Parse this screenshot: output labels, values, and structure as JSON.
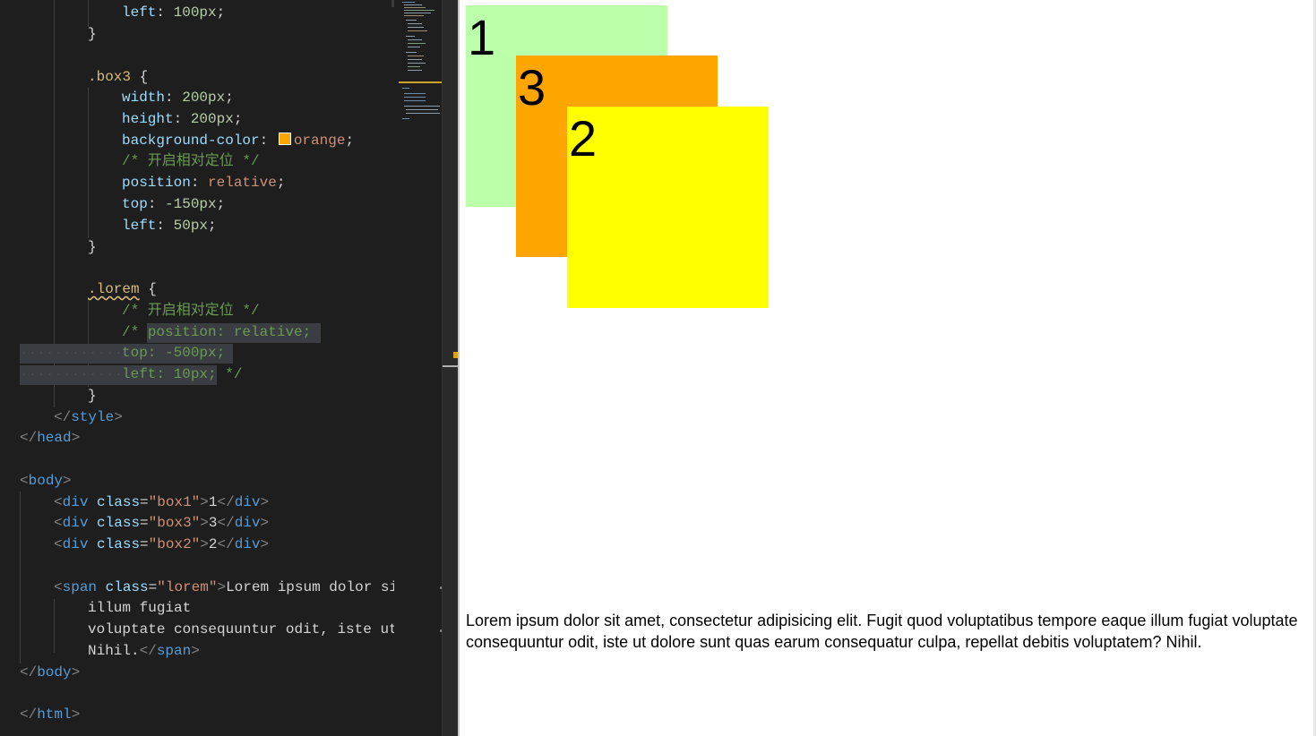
{
  "editor": {
    "css_lines": {
      "l1_prop": "left",
      "l1_val": "100px",
      "box3_selector": ".box3",
      "width_prop": "width",
      "width_val": "200px",
      "height_prop": "height",
      "height_val": "200px",
      "bg_prop": "background-color",
      "bg_val": "orange",
      "comment1": "/* 开启相对定位 */",
      "pos_prop": "position",
      "pos_val": "relative",
      "top_prop": "top",
      "top_val": "-150px",
      "left_prop": "left",
      "left_val": "50px",
      "lorem_selector": ".lorem",
      "comment2": "/* 开启相对定位 */",
      "c_line1_prefix": "/* ",
      "c_line1": "position: relative;",
      "c_line2": "top: -500px;",
      "c_line3": "left: 10px;",
      "c_line3_end": " */"
    },
    "html_lines": {
      "style_close": "style",
      "head_close": "head",
      "body_open": "body",
      "div": "div",
      "class_attr": "class",
      "box1_class": "\"box1\"",
      "box1_text": "1",
      "box3_class": "\"box3\"",
      "box3_text": "3",
      "box2_class": "\"box2\"",
      "box2_text": "2",
      "span": "span",
      "lorem_class": "\"lorem\"",
      "span_text1": "Lorem ipsum dolor si",
      "span_text2": "illum fugiat",
      "span_text3": "voluptate consequuntur odit, iste ut",
      "span_text4": "Nihil.",
      "body_close": "body",
      "html_close": "html"
    },
    "swatch_color": "#ffa500"
  },
  "preview": {
    "box1": {
      "label": "1",
      "color": "#bbffaa"
    },
    "box3": {
      "label": "3",
      "color": "#ffa500"
    },
    "box2": {
      "label": "2",
      "color": "#ffff00"
    },
    "lorem": "Lorem ipsum dolor sit amet, consectetur adipisicing elit. Fugit quod voluptatibus tempore eaque illum fugiat voluptate consequuntur odit, iste ut dolore sunt quas earum consequatur culpa, repellat debitis voluptatem? Nihil."
  }
}
